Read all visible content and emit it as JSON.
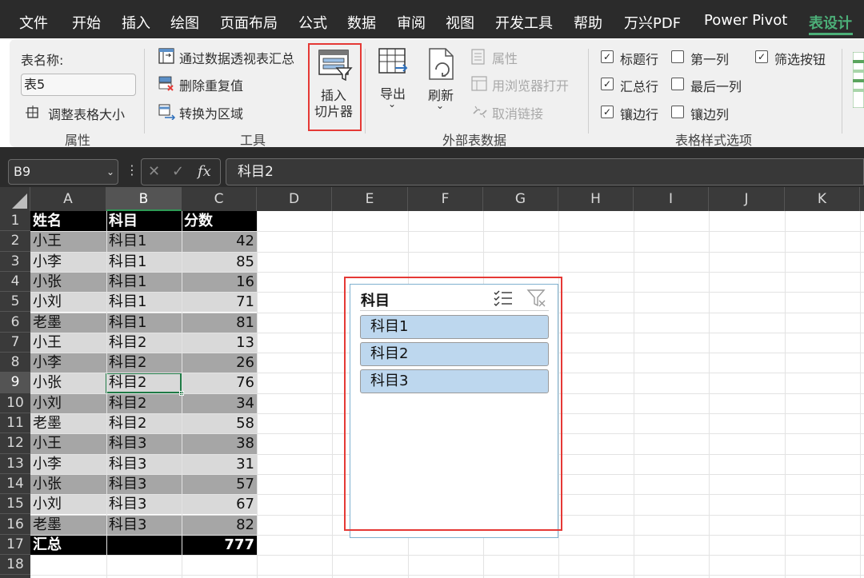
{
  "menu_tabs": [
    "文件",
    "开始",
    "插入",
    "绘图",
    "页面布局",
    "公式",
    "数据",
    "审阅",
    "视图",
    "开发工具",
    "帮助",
    "万兴PDF",
    "Power Pivot",
    "表设计"
  ],
  "ribbon": {
    "properties": {
      "table_name_label": "表名称:",
      "table_name_value": "表5",
      "resize_label": "调整表格大小",
      "group_label": "属性"
    },
    "tools": {
      "pivot_label": "通过数据透视表汇总",
      "dedupe_label": "删除重复值",
      "convert_label": "转换为区域",
      "slicer_line1": "插入",
      "slicer_line2": "切片器",
      "group_label": "工具"
    },
    "external": {
      "export_label": "导出",
      "refresh_label": "刷新",
      "props_label": "属性",
      "browser_label": "用浏览器打开",
      "unlink_label": "取消链接",
      "group_label": "外部表数据"
    },
    "style_options": {
      "header_row": "标题行",
      "total_row": "汇总行",
      "banded_rows": "镶边行",
      "first_col": "第一列",
      "last_col": "最后一列",
      "banded_cols": "镶边列",
      "filter_btn": "筛选按钮",
      "group_label": "表格样式选项"
    }
  },
  "formula_bar": {
    "name_box": "B9",
    "formula": "科目2",
    "fx": "fx"
  },
  "columns": [
    "A",
    "B",
    "C",
    "D",
    "E",
    "F",
    "G",
    "H",
    "I",
    "J",
    "K"
  ],
  "rows": [
    "1",
    "2",
    "3",
    "4",
    "5",
    "6",
    "7",
    "8",
    "9",
    "10",
    "11",
    "12",
    "13",
    "14",
    "15",
    "16",
    "17",
    "18"
  ],
  "table": {
    "headers": [
      "姓名",
      "科目",
      "分数"
    ],
    "rows": [
      [
        "小王",
        "科目1",
        "42"
      ],
      [
        "小李",
        "科目1",
        "85"
      ],
      [
        "小张",
        "科目1",
        "16"
      ],
      [
        "小刘",
        "科目1",
        "71"
      ],
      [
        "老墨",
        "科目1",
        "81"
      ],
      [
        "小王",
        "科目2",
        "13"
      ],
      [
        "小李",
        "科目2",
        "26"
      ],
      [
        "小张",
        "科目2",
        "76"
      ],
      [
        "小刘",
        "科目2",
        "34"
      ],
      [
        "老墨",
        "科目2",
        "58"
      ],
      [
        "小王",
        "科目3",
        "38"
      ],
      [
        "小李",
        "科目3",
        "31"
      ],
      [
        "小张",
        "科目3",
        "57"
      ],
      [
        "小刘",
        "科目3",
        "67"
      ],
      [
        "老墨",
        "科目3",
        "82"
      ]
    ],
    "total_label": "汇总",
    "total_value": "777"
  },
  "slicer": {
    "title": "科目",
    "items": [
      "科目1",
      "科目2",
      "科目3"
    ]
  }
}
